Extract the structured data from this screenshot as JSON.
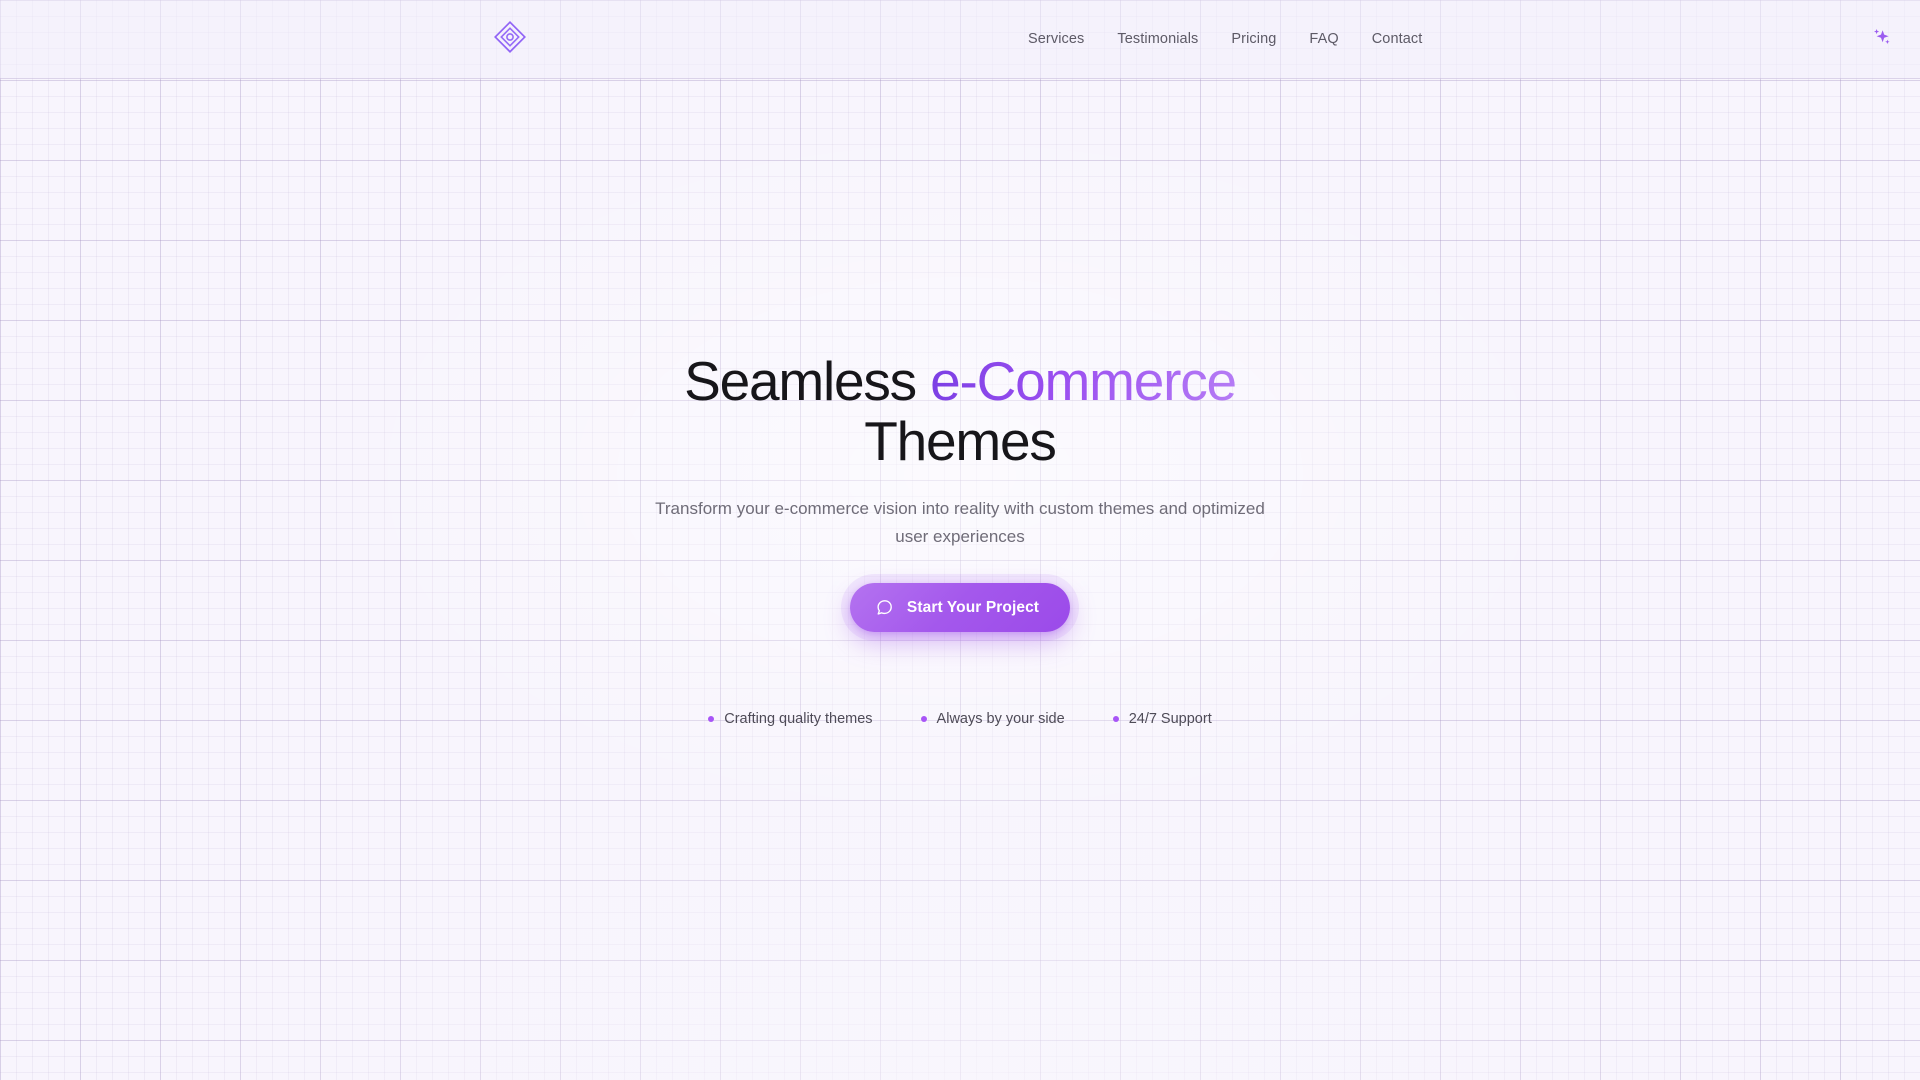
{
  "header": {
    "logo": {
      "icon": "diamond-logo-icon",
      "alt": "Brand logo"
    },
    "nav": [
      {
        "label": "Services"
      },
      {
        "label": "Testimonials"
      },
      {
        "label": "Pricing"
      },
      {
        "label": "FAQ"
      },
      {
        "label": "Contact"
      }
    ],
    "sparkle": {
      "icon": "sparkles-icon"
    }
  },
  "hero": {
    "title_leading": "Seamless ",
    "title_accent": "e-Commerce",
    "title_trailing": " Themes",
    "subtitle": "Transform your e-commerce vision into reality with custom themes and optimized user experiences",
    "cta": {
      "label": "Start Your Project",
      "icon": "chat-bubble-icon"
    },
    "features": [
      {
        "label": "Crafting quality themes"
      },
      {
        "label": "Always by your side"
      },
      {
        "label": "24/7 Support"
      }
    ]
  },
  "colors": {
    "page_background": "#f8f5fd",
    "grid_line": "#a08cbe",
    "accent_purple": "#a855f7",
    "accent_violet": "#7b3fe4",
    "accent_light": "#b57cf5",
    "heading_text": "#17161a",
    "body_text": "#6f6c78",
    "nav_text": "#5d5a66",
    "cta_text": "#ffffff"
  }
}
